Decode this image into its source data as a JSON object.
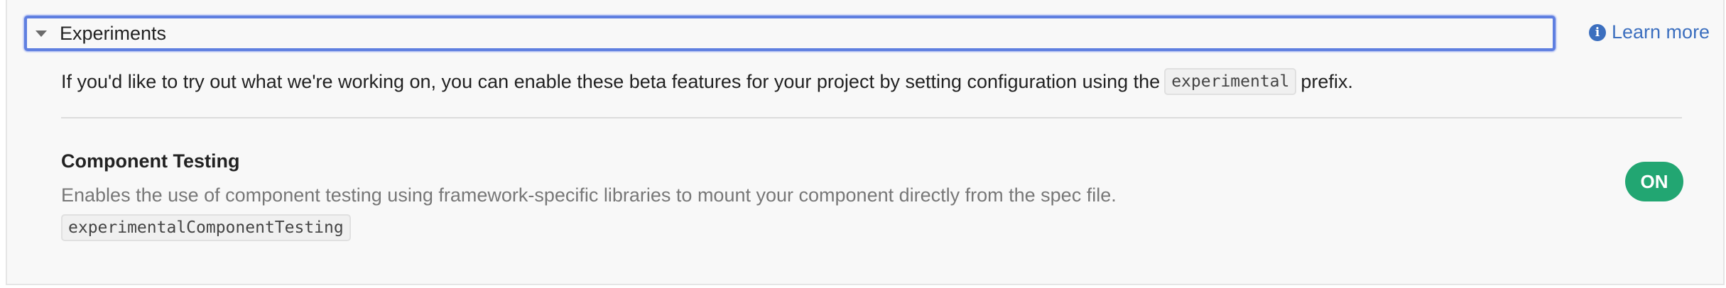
{
  "section": {
    "title": "Experiments",
    "learn_more": "Learn more",
    "intro_before": "If you'd like to try out what we're working on, you can enable these beta features for your project by setting configuration using the",
    "intro_code": "experimental",
    "intro_after": "prefix."
  },
  "feature": {
    "title": "Component Testing",
    "description": "Enables the use of component testing using framework-specific libraries to mount your component directly from the spec file.",
    "config_key": "experimentalComponentTesting",
    "toggle_label": "ON"
  },
  "icons": {
    "caret": "caret-down-icon",
    "info": "info-icon"
  },
  "colors": {
    "accent": "#3c6fbf",
    "focus_border": "#5f7fe0",
    "toggle_on": "#22a672"
  }
}
